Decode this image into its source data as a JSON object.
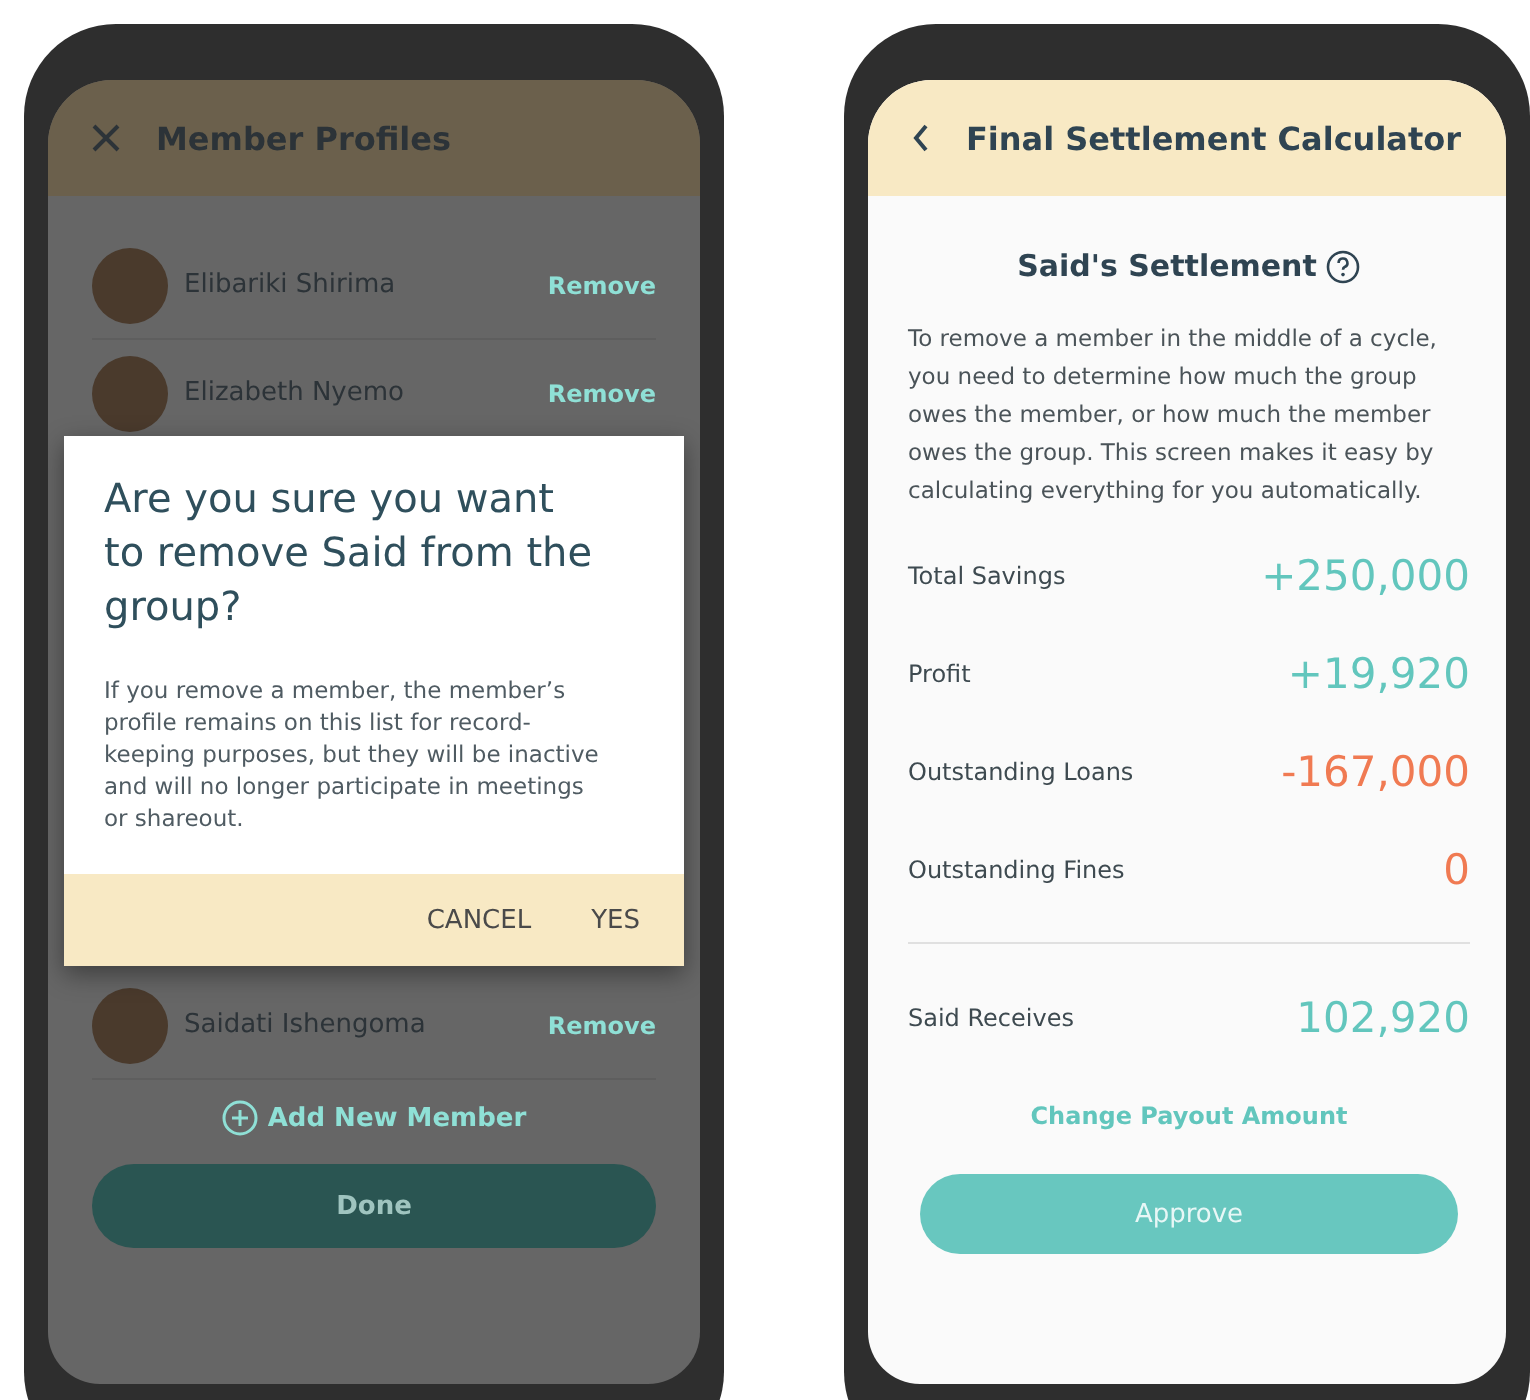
{
  "member_profiles": {
    "title": "Member Profiles",
    "members": [
      {
        "name": "Elibariki Shirima",
        "action": "Remove"
      },
      {
        "name": "Elizabeth Nyemo",
        "action": "Remove"
      },
      {
        "name": "Saidati Ishengoma",
        "action": "Remove"
      }
    ],
    "add_link": "Add New Member",
    "done_button": "Done",
    "dialog": {
      "title": "Are you sure you want to remove Said from the group?",
      "body": "If you remove a member, the member’s profile remains on this list for record-keeping purposes, but they will be inactive and will no longer participate in meetings or shareout.",
      "buttons": [
        "CANCEL",
        "YES"
      ]
    }
  },
  "settlement": {
    "title": "Final Settlement Calculator",
    "heading": "Said's Settlement",
    "description": "To remove a member in the middle of a cycle, you need to determine how much the group owes the member, or how much the member owes the group. This screen makes it easy by calculating everything for you automatically.",
    "rows": [
      {
        "label": "Total Savings",
        "value": "+250,000",
        "color": "#62c6bd"
      },
      {
        "label": "Profit",
        "value": "+19,920",
        "color": "#62c6bd"
      },
      {
        "label": "Outstanding Loans",
        "value": "-167,000",
        "color": "#f07a52"
      },
      {
        "label": "Outstanding Fines",
        "value": "0",
        "color": "#f07a52"
      }
    ],
    "total": {
      "label": "Said Receives",
      "value": "102,920",
      "color": "#62c6bd"
    },
    "link": "Change Payout Amount",
    "approve_button": "Approve"
  }
}
